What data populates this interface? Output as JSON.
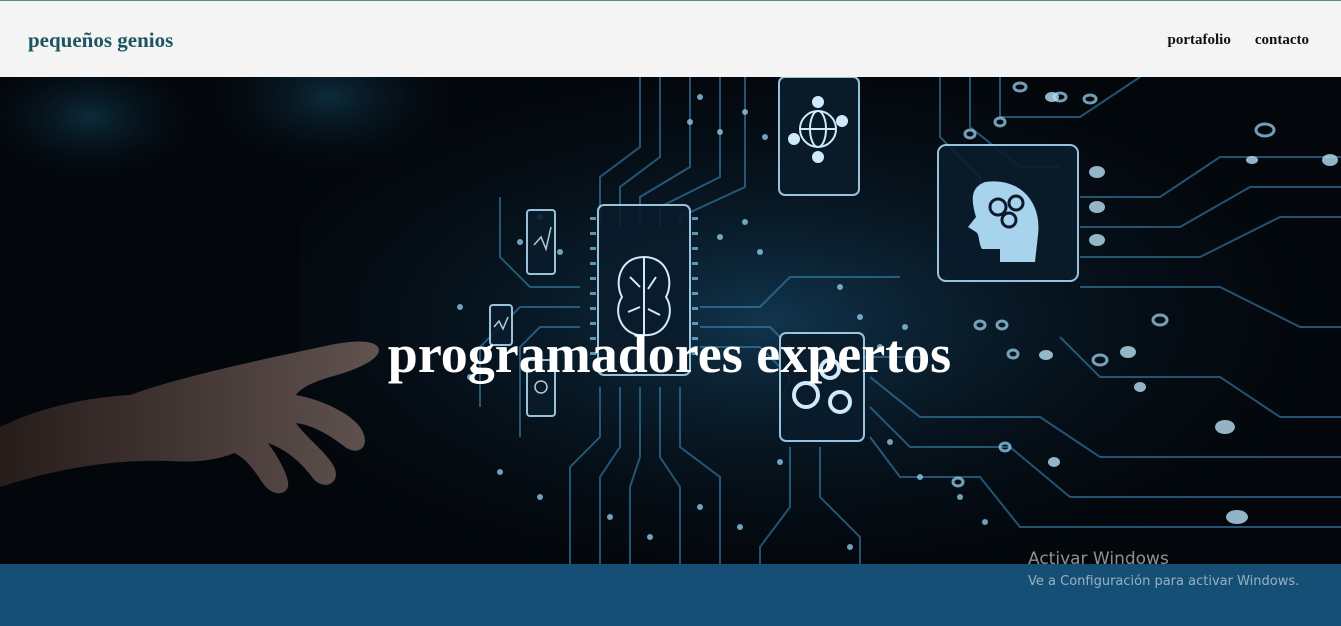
{
  "navbar": {
    "brand": "pequeños genios",
    "links": [
      {
        "label": "portafolio"
      },
      {
        "label": "contacto"
      }
    ]
  },
  "hero": {
    "title": "programadores expertos"
  },
  "watermark": {
    "title": "Activar Windows",
    "subtitle": "Ve a Configuración para activar Windows."
  },
  "colors": {
    "navbar_bg": "#f4f4f5",
    "brand": "#1c5560",
    "footer_band": "#154f75",
    "circuit": "#5ea8d6"
  },
  "icons": [
    "globe-icon",
    "brain-chip-icon",
    "head-gears-icon",
    "gears-icon",
    "pointing-hand-icon"
  ]
}
